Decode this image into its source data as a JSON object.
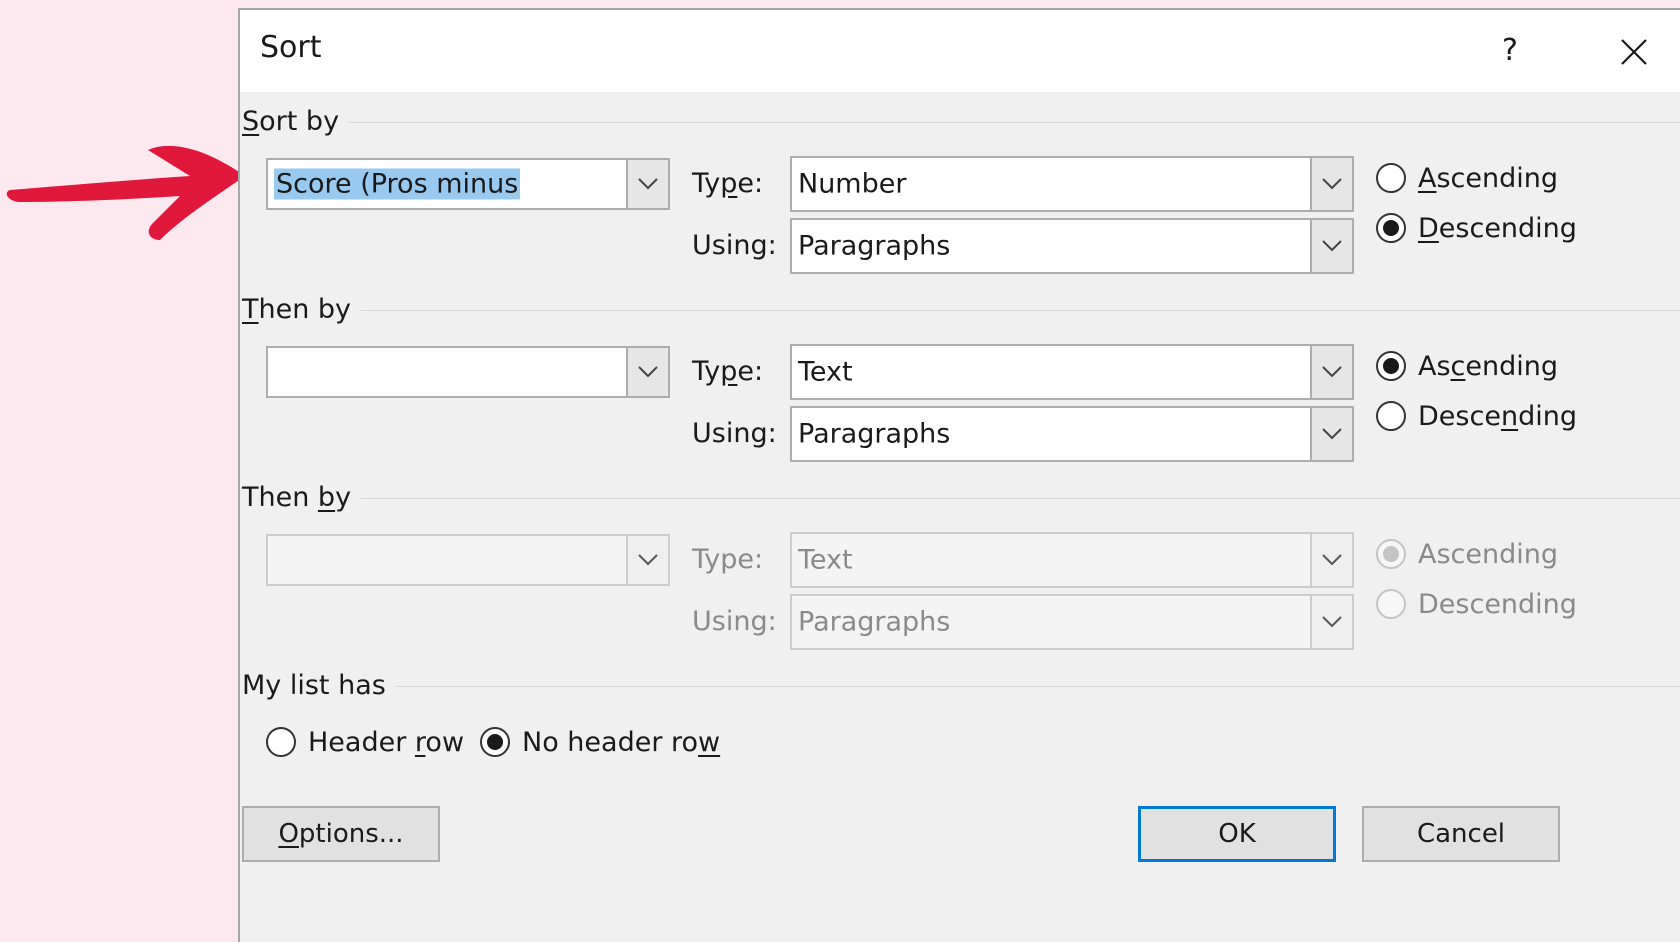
{
  "dialog": {
    "title": "Sort",
    "help_label": "?"
  },
  "sort_by": {
    "label_pre": "",
    "label_key": "S",
    "label_post": "ort by",
    "field_value": "Score (Pros minus",
    "type_label_pre": "Ty",
    "type_label_key": "p",
    "type_label_post": "e:",
    "type_value": "Number",
    "using_label": "Using:",
    "using_value": "Paragraphs",
    "asc_pre": "",
    "asc_key": "A",
    "asc_post": "scending",
    "desc_pre": "",
    "desc_key": "D",
    "desc_post": "escending",
    "order": "descending"
  },
  "then_by_1": {
    "label_pre": "",
    "label_key": "T",
    "label_post": "hen by",
    "field_value": "",
    "type_label_pre": "Ty",
    "type_label_key": "p",
    "type_label_post": "e:",
    "type_value": "Text",
    "using_label": "Using:",
    "using_value": "Paragraphs",
    "asc_pre": "As",
    "asc_key": "c",
    "asc_post": "ending",
    "desc_pre": "Desce",
    "desc_key": "n",
    "desc_post": "ding",
    "order": "ascending"
  },
  "then_by_2": {
    "label_pre": "Then ",
    "label_key": "b",
    "label_post": "y",
    "field_value": "",
    "type_label": "Type:",
    "type_value": "Text",
    "using_label": "Using:",
    "using_value": "Paragraphs",
    "asc_label": "Ascending",
    "desc_label": "Descending",
    "order": "ascending",
    "disabled": true
  },
  "list_header": {
    "label": "My list has",
    "header_row_pre": "Header ",
    "header_row_key": "r",
    "header_row_post": "ow",
    "no_header_row_pre": "No header ro",
    "no_header_row_key": "w",
    "no_header_row_post": "",
    "selected": "no_header_row"
  },
  "buttons": {
    "options_pre": "",
    "options_key": "O",
    "options_post": "ptions...",
    "ok": "OK",
    "cancel": "Cancel"
  },
  "colors": {
    "annotation_arrow": "#e0193c",
    "page_background": "#fde8ef",
    "dialog_background": "#f0f0f0",
    "default_button_border": "#0078d7",
    "selection_highlight": "#99c9ef"
  }
}
